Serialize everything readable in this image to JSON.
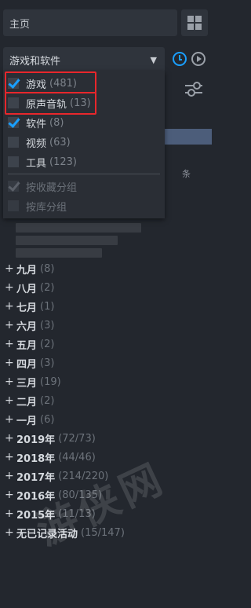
{
  "header": {
    "home_label": "主页"
  },
  "filter": {
    "selected": "游戏和软件",
    "chevron": "chevron-down-icon"
  },
  "dropdown": {
    "options": [
      {
        "label": "游戏",
        "count": "(481)",
        "checked": true
      },
      {
        "label": "原声音轨",
        "count": "(13)",
        "checked": false
      },
      {
        "label": "软件",
        "count": "(8)",
        "checked": true
      },
      {
        "label": "视频",
        "count": "(63)",
        "checked": false
      },
      {
        "label": "工具",
        "count": "(123)",
        "checked": false
      }
    ],
    "grouping": [
      {
        "label": "按收藏分组",
        "checked": true
      },
      {
        "label": "按库分组",
        "checked": false
      }
    ]
  },
  "partial_text": "条",
  "months": [
    {
      "label": "九月",
      "count": "(8)"
    },
    {
      "label": "八月",
      "count": "(2)"
    },
    {
      "label": "七月",
      "count": "(1)"
    },
    {
      "label": "六月",
      "count": "(3)"
    },
    {
      "label": "五月",
      "count": "(2)"
    },
    {
      "label": "四月",
      "count": "(3)"
    },
    {
      "label": "三月",
      "count": "(19)"
    },
    {
      "label": "二月",
      "count": "(2)"
    },
    {
      "label": "一月",
      "count": "(6)"
    },
    {
      "label": "2019年",
      "count": "(72/73)"
    },
    {
      "label": "2018年",
      "count": "(44/46)"
    },
    {
      "label": "2017年",
      "count": "(214/220)"
    },
    {
      "label": "2016年",
      "count": "(80/135)"
    },
    {
      "label": "2015年",
      "count": "(11/13)"
    },
    {
      "label": "无已记录活动",
      "count": "(15/147)"
    }
  ],
  "colors": {
    "accent": "#1a9fff",
    "highlight": "#e8272c",
    "background": "#23272e"
  }
}
